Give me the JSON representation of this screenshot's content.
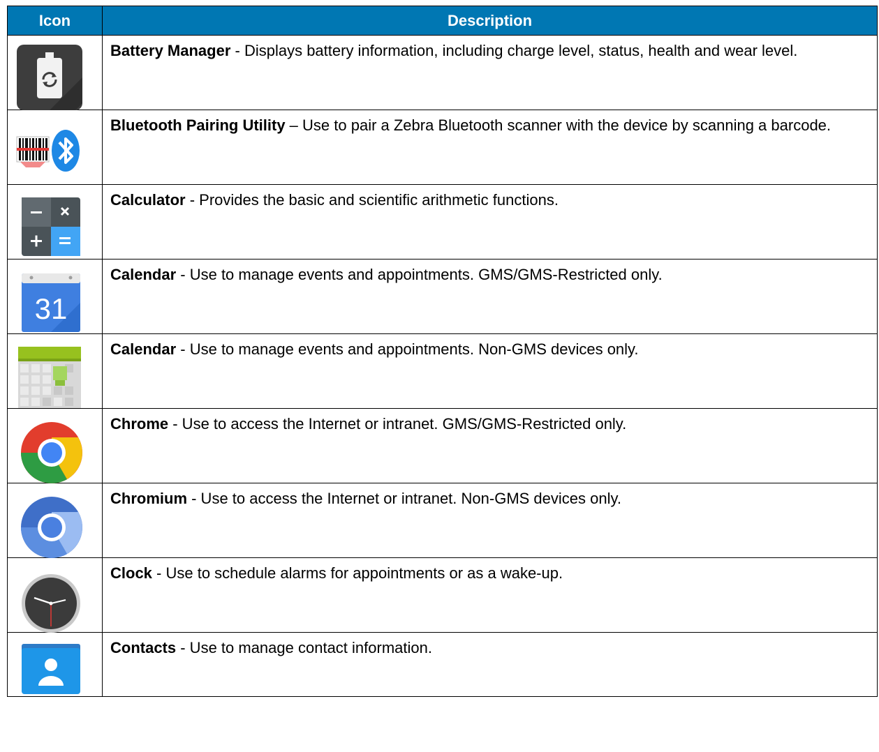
{
  "header": {
    "icon": "Icon",
    "description": "Description"
  },
  "rows": [
    {
      "icon": "battery-manager-icon",
      "name": "Battery Manager",
      "text": " - Displays battery information, including charge level, status, health and wear level."
    },
    {
      "icon": "bluetooth-pairing-icon",
      "name": "Bluetooth Pairing Utility",
      "text": " – Use to pair a Zebra Bluetooth scanner with the device by scanning a barcode."
    },
    {
      "icon": "calculator-icon",
      "name": "Calculator",
      "text": " - Provides the basic and scientific arithmetic functions."
    },
    {
      "icon": "google-calendar-icon",
      "name": "Calendar",
      "text": " - Use to manage events and appointments. GMS/GMS-Restricted only.",
      "icon_text": "31"
    },
    {
      "icon": "calendar-icon",
      "name": "Calendar",
      "text": " - Use to manage events and appointments. Non-GMS devices only."
    },
    {
      "icon": "chrome-icon",
      "name": "Chrome",
      "text": " - Use to access the Internet or intranet. GMS/GMS-Restricted only."
    },
    {
      "icon": "chromium-icon",
      "name": "Chromium",
      "text": " - Use to access the Internet or intranet. Non-GMS devices only."
    },
    {
      "icon": "clock-icon",
      "name": "Clock",
      "text": " - Use to schedule alarms for appointments or as a wake-up."
    },
    {
      "icon": "contacts-icon",
      "name": "Contacts",
      "text": " - Use to manage contact information."
    }
  ],
  "colors": {
    "header_bg": "#0077b3",
    "header_text": "#ffffff"
  }
}
